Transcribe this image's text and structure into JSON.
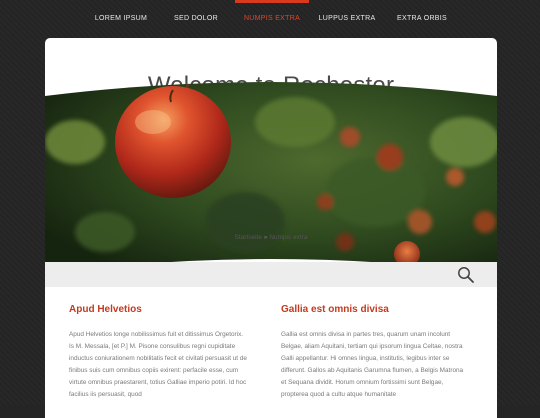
{
  "nav": {
    "items": [
      {
        "label": "LOREM IPSUM"
      },
      {
        "label": "SED DOLOR"
      },
      {
        "label": "NUMPIS EXTRA",
        "active": true
      },
      {
        "label": "LUPPUS EXTRA"
      },
      {
        "label": "EXTRA ORBIS"
      }
    ]
  },
  "header": {
    "title": "Welcome to Rochester"
  },
  "breadcrumb": {
    "home": "Startseite",
    "separator": "»",
    "current": "Numpis extra"
  },
  "columns": [
    {
      "heading": "Apud Helvetios",
      "text": "Apud Helvetios longe nobilissimus fuit et ditissimus Orgetorix. Is M. Messala, [et P.] M. Pisone consulibus regni cupiditate inductus coniurationem nobilitatis fecit et civitati persuasit ut de finibus suis cum omnibus copiis exirent: perfacile esse, cum virtute omnibus praestarent, totius Galliae imperio potiri. Id hoc facilius iis persuasit, quod"
    },
    {
      "heading": "Gallia est omnis divisa",
      "text": "Gallia est omnis divisa in partes tres, quarum unam incolunt Belgae, aliam Aquitani, tertiam qui ipsorum lingua Celtae, nostra Galli appellantur. Hi omnes lingua, institutis, legibus inter se differunt. Gallos ab Aquitanis Garumna flumen, a Belgis Matrona et Sequana dividit. Horum omnium fortissimi sunt Belgae, propterea quod a cultu atque humanitate"
    }
  ],
  "colors": {
    "accent": "#d73a1c",
    "heading": "#c43a1f",
    "background": "#252525"
  },
  "icons": {
    "search": "search-icon"
  }
}
